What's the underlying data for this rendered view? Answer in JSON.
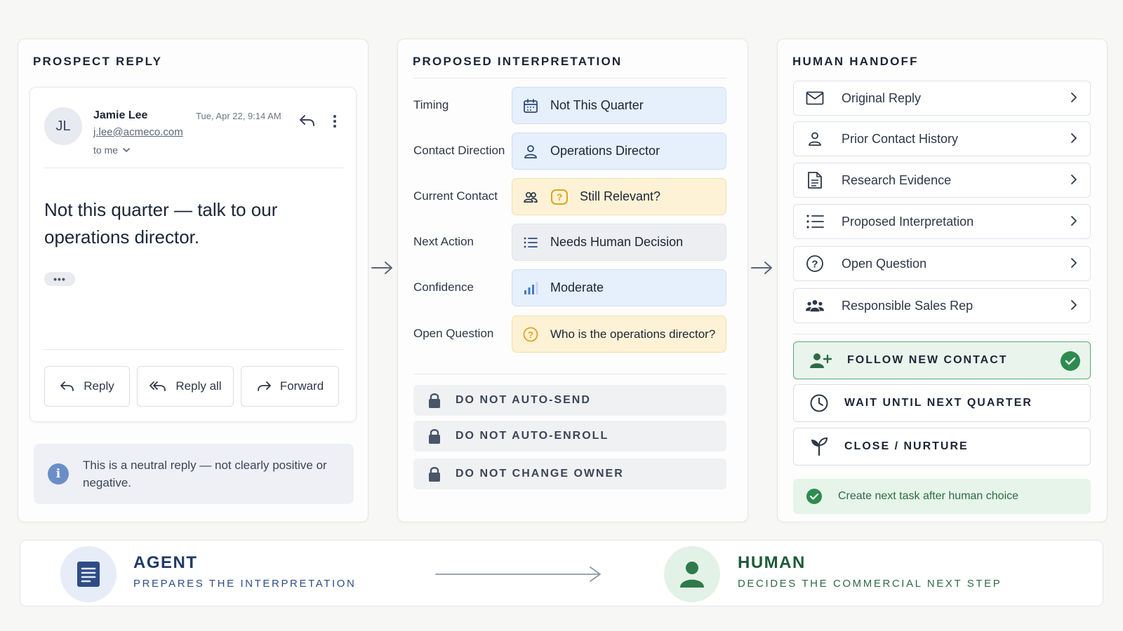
{
  "prospect_reply": {
    "title": "PROSPECT REPLY",
    "sender": {
      "initials": "JL",
      "name": "Jamie Lee",
      "email": "j.lee@acmeco.com",
      "to": "to me",
      "date": "Tue, Apr 22, 9:14 AM"
    },
    "body": "Not this quarter — talk to our operations director.",
    "ellipsis": "•••",
    "buttons": {
      "reply": "Reply",
      "reply_all": "Reply all",
      "forward": "Forward"
    },
    "note": "This is a neutral reply — not clearly positive or negative."
  },
  "interpretation": {
    "title": "PROPOSED INTERPRETATION",
    "rows": [
      {
        "label": "Timing",
        "value": "Not This Quarter",
        "icon": "calendar-icon",
        "style": "blue"
      },
      {
        "label": "Contact Direction",
        "value": "Operations Director",
        "icon": "person-icon",
        "style": "blue"
      },
      {
        "label": "Current Contact",
        "value": "Still Relevant?",
        "icon": "people-icon",
        "style": "yellow"
      },
      {
        "label": "Next Action",
        "value": "Needs Human Decision",
        "icon": "list-icon",
        "style": "gray"
      },
      {
        "label": "Confidence",
        "value": "Moderate",
        "icon": "signal-bars-icon",
        "style": "blue"
      },
      {
        "label": "Open Question",
        "value": "Who is the operations director?",
        "icon": "question-circle-icon",
        "style": "yellow"
      }
    ],
    "guardrails": [
      "DO NOT AUTO-SEND",
      "DO NOT AUTO-ENROLL",
      "DO NOT CHANGE OWNER"
    ]
  },
  "handoff": {
    "title": "HUMAN HANDOFF",
    "items": [
      {
        "label": "Original Reply",
        "icon": "envelope-icon"
      },
      {
        "label": "Prior Contact History",
        "icon": "person-icon"
      },
      {
        "label": "Research Evidence",
        "icon": "document-icon"
      },
      {
        "label": "Proposed Interpretation",
        "icon": "list-icon"
      },
      {
        "label": "Open Question",
        "icon": "question-circle-icon"
      },
      {
        "label": "Responsible Sales Rep",
        "icon": "team-icon"
      }
    ],
    "choices": [
      {
        "label": "FOLLOW NEW CONTACT",
        "selected": true,
        "icon": "add-person-icon"
      },
      {
        "label": "WAIT UNTIL NEXT QUARTER",
        "selected": false,
        "icon": "clock-icon"
      },
      {
        "label": "CLOSE / NURTURE",
        "selected": false,
        "icon": "sprout-icon"
      }
    ],
    "next_task": "Create next task after human choice"
  },
  "bottom": {
    "agent": {
      "title": "AGENT",
      "subtitle": "PREPARES THE INTERPRETATION"
    },
    "human": {
      "title": "HUMAN",
      "subtitle": "DECIDES THE COMMERCIAL NEXT STEP"
    }
  },
  "colors": {
    "accent_blue": "#1f3a68",
    "accent_green": "#2e6b44",
    "blue_chip": "#e6effc",
    "yellow_chip": "#fdf2d6",
    "selected_green": "#e9f5ec"
  }
}
